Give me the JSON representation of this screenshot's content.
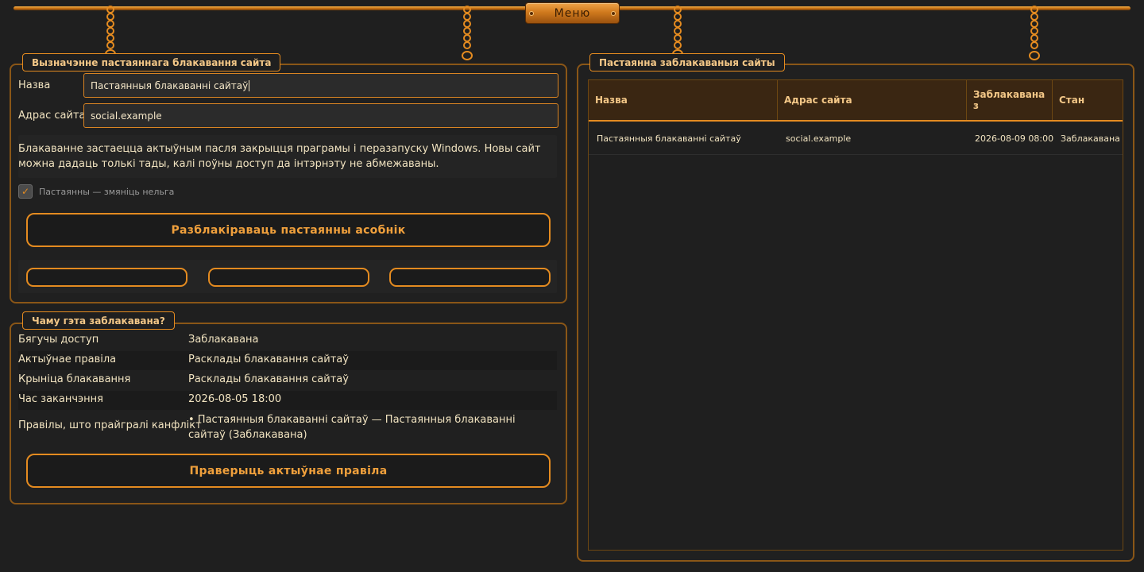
{
  "menu": {
    "label": "Меню"
  },
  "definition": {
    "title": "Вызначэнне пастаяннага блакавання сайта",
    "name_label": "Назва",
    "name_value": "Пастаянныя блакаванні сайтаў",
    "address_label": "Адрас сайта",
    "address_value": "social.example",
    "info_text": "Блакаванне застаецца актыўным пасля закрыцця праграмы і перазапуску Windows. Новы сайт можна дадаць толькі тады, калі поўны доступ да інтэрнэту не абмежаваны.",
    "permanent_label": "Пастаянны — змяніць нельга",
    "permanent_checked": true,
    "unblock_button": "Разблакіраваць пастаянны асобнік"
  },
  "why": {
    "title": "Чаму гэта заблакавана?",
    "rows": [
      {
        "key": "Бягучы доступ",
        "value": "Заблакавана"
      },
      {
        "key": "Актыўнае правіла",
        "value": "Расклады блакавання сайтаў"
      },
      {
        "key": "Крыніца блакавання",
        "value": "Расклады блакавання сайтаў"
      },
      {
        "key": "Час заканчэння",
        "value": "2026-08-05 18:00"
      },
      {
        "key": "Правілы, што прайгралі канфлікт",
        "value": "• Пастаянныя блакаванні сайтаў — Пастаянныя блакаванні сайтаў (Заблакавана)"
      }
    ],
    "check_button": "Праверыць актыўнае правіла"
  },
  "blocked": {
    "title": "Пастаянна заблакаваныя сайты",
    "columns": [
      "Назва",
      "Адрас сайта",
      "Заблакавана з",
      "Стан"
    ],
    "rows": [
      [
        "Пастаянныя блакаванні сайтаў",
        "social.example",
        "2026-08-09 08:00",
        "Заблакавана"
      ]
    ]
  },
  "colors": {
    "accent": "#e48b20",
    "background": "#1f1f1f",
    "text": "#f1e3c0"
  }
}
